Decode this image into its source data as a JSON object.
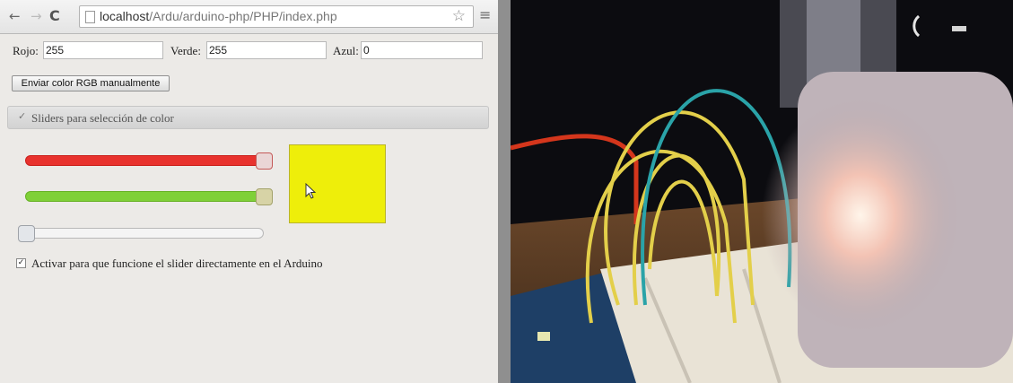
{
  "browser": {
    "url_host": "localhost",
    "url_path": "/Ardu/arduino-php/PHP/index.php",
    "nav": {
      "back": "←",
      "forward": "→",
      "reload": "C"
    },
    "star": "☆",
    "menu": "≡"
  },
  "form": {
    "rojo_label": "Rojo:",
    "rojo_value": "255",
    "verde_label": "Verde:",
    "verde_value": "255",
    "azul_label": "Azul:",
    "azul_value": "0",
    "send_button": "Enviar color RGB manualmente"
  },
  "accordion": {
    "title": "Sliders para selección de color",
    "icon": "✓"
  },
  "sliders": {
    "red": 255,
    "green": 255,
    "blue": 0,
    "max": 255
  },
  "swatch_color": "#eeee0a",
  "checkbox": {
    "checked": true,
    "mark": "✓",
    "label": "Activar para que funcione el slider directamente en el Arduino"
  },
  "colors": {
    "red_track": "#e8322e",
    "green_track": "#7fd038",
    "page_bg": "#eceae7"
  }
}
